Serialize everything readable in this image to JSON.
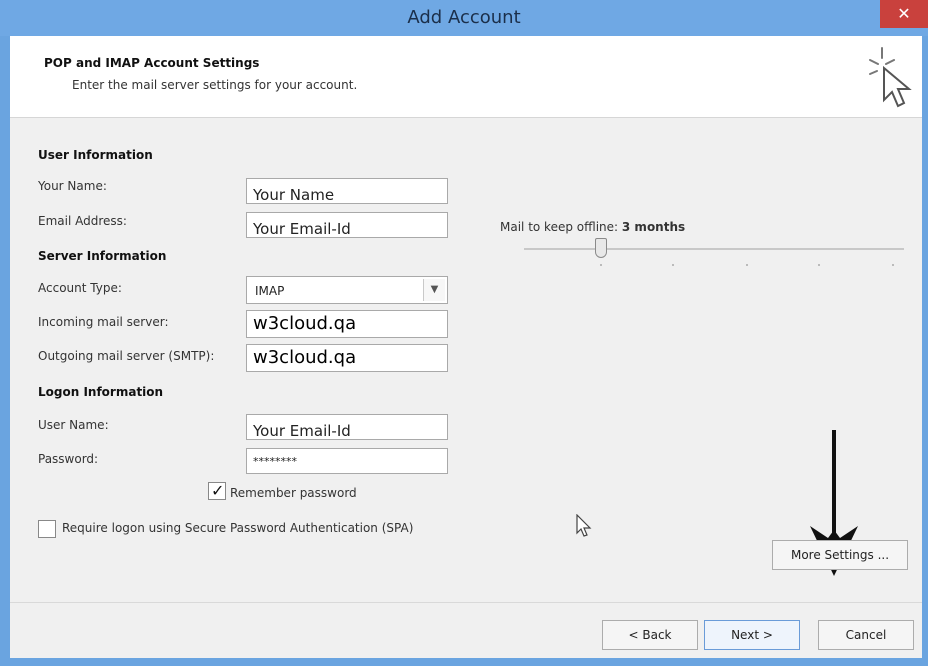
{
  "window": {
    "title": "Add Account",
    "close_glyph": "✕"
  },
  "header": {
    "title": "POP and IMAP Account Settings",
    "subtitle": "Enter the mail server settings for your account.",
    "icon": "wizard-cursor-icon"
  },
  "user_info": {
    "heading": "User Information",
    "name_label": "Your Name:",
    "name_value": "Your Name",
    "email_label": "Email Address:",
    "email_value": "Your Email-Id"
  },
  "server_info": {
    "heading": "Server Information",
    "account_type_label": "Account Type:",
    "account_type_value": "IMAP",
    "incoming_label": "Incoming mail server:",
    "incoming_value": "w3cloud.qa",
    "outgoing_label": "Outgoing mail server (SMTP):",
    "outgoing_value": "w3cloud.qa"
  },
  "logon_info": {
    "heading": "Logon Information",
    "username_label": "User Name:",
    "username_value": "Your Email-Id",
    "password_label": "Password:",
    "password_value": "********",
    "remember_label": "Remember password",
    "remember_checked": true,
    "spa_label": "Require logon using Secure Password Authentication (SPA)",
    "spa_checked": false
  },
  "offline": {
    "label": "Mail to keep offline:",
    "value": "3 months"
  },
  "buttons": {
    "more_settings": "More Settings ...",
    "back": "< Back",
    "next": "Next >",
    "cancel": "Cancel"
  }
}
